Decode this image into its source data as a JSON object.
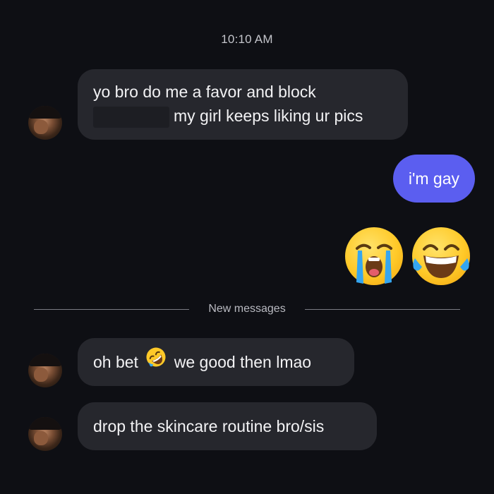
{
  "chat": {
    "timestamp": "10:10 AM",
    "msg1": {
      "line1": "yo bro do me a favor and block",
      "line2": "my girl keeps liking ur pics"
    },
    "msg2": "i'm gay",
    "emoji_reactions": [
      "loudly-crying-face",
      "face-with-tears-of-joy"
    ],
    "divider_label": "New messages",
    "msg3": {
      "before": "oh bet",
      "emoji": "rolling-on-the-floor-laughing",
      "after": "we good then lmao"
    },
    "msg4": "drop the skincare routine bro/sis"
  },
  "colors": {
    "background": "#0e0f14",
    "incoming_bubble": "#26272d",
    "outgoing_bubble": "#5b5ef0",
    "text": "#f2f2f4"
  }
}
